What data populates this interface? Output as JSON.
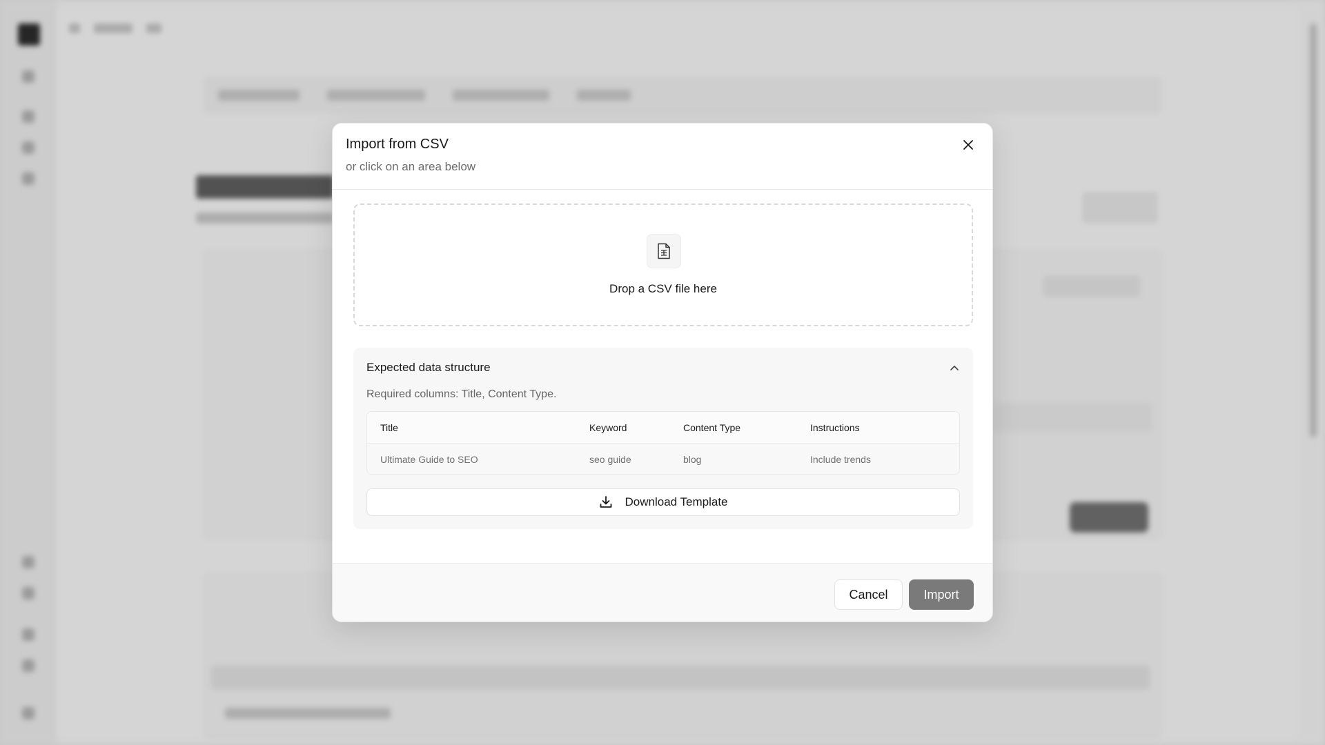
{
  "modal": {
    "title": "Import from CSV",
    "subtitle": "or click on an area below",
    "close_icon": "close-icon"
  },
  "dropzone": {
    "icon": "file-spreadsheet-icon",
    "text": "Drop a CSV file here"
  },
  "structure": {
    "title": "Expected data structure",
    "toggle_icon": "chevron-up-icon",
    "required_text": "Required columns: Title, Content Type.",
    "columns": [
      "Title",
      "Keyword",
      "Content Type",
      "Instructions"
    ],
    "rows": [
      [
        "Ultimate Guide to SEO",
        "seo guide",
        "blog",
        "Include trends"
      ]
    ]
  },
  "download": {
    "icon": "download-icon",
    "label": "Download Template"
  },
  "footer": {
    "cancel_label": "Cancel",
    "import_label": "Import"
  },
  "colors": {
    "import_button": "#7a7a7a",
    "modal_background": "#ffffff",
    "backdrop": "#d9d9d9"
  }
}
